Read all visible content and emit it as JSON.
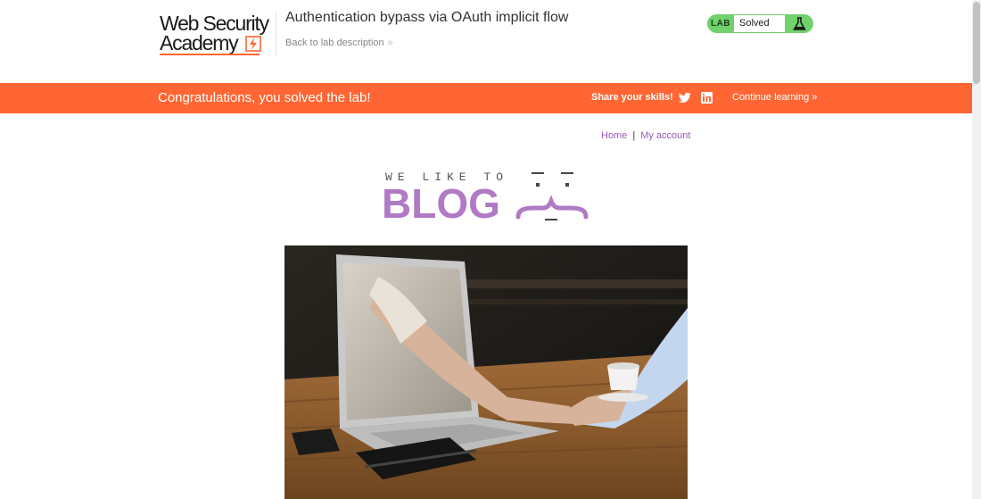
{
  "header": {
    "logo": {
      "line1": "Web Security",
      "line2": "Academy"
    },
    "lab_title": "Authentication bypass via OAuth implicit flow",
    "back_link": "Back to lab description",
    "back_chevron": "»",
    "status": {
      "tag": "LAB",
      "state": "Solved",
      "icon": "lab-flask-icon"
    }
  },
  "notification": {
    "message": "Congratulations, you solved the lab!",
    "share_label": "Share your skills!",
    "share_icons": [
      "twitter-icon",
      "linkedin-icon"
    ],
    "continue_label": "Continue learning",
    "continue_chevron": "»"
  },
  "blog_nav": {
    "home": "Home",
    "separator": "|",
    "account": "My account"
  },
  "blog_header": {
    "tagline": "WE LIKE TO",
    "title": "BLOG"
  },
  "post_image": {
    "description": "handshake-through-laptop-photo"
  },
  "colors": {
    "brand_orange": "#ff6633",
    "status_green": "#70d16d",
    "link_purple": "#9b59b6",
    "blog_purple": "#b07ac5"
  }
}
